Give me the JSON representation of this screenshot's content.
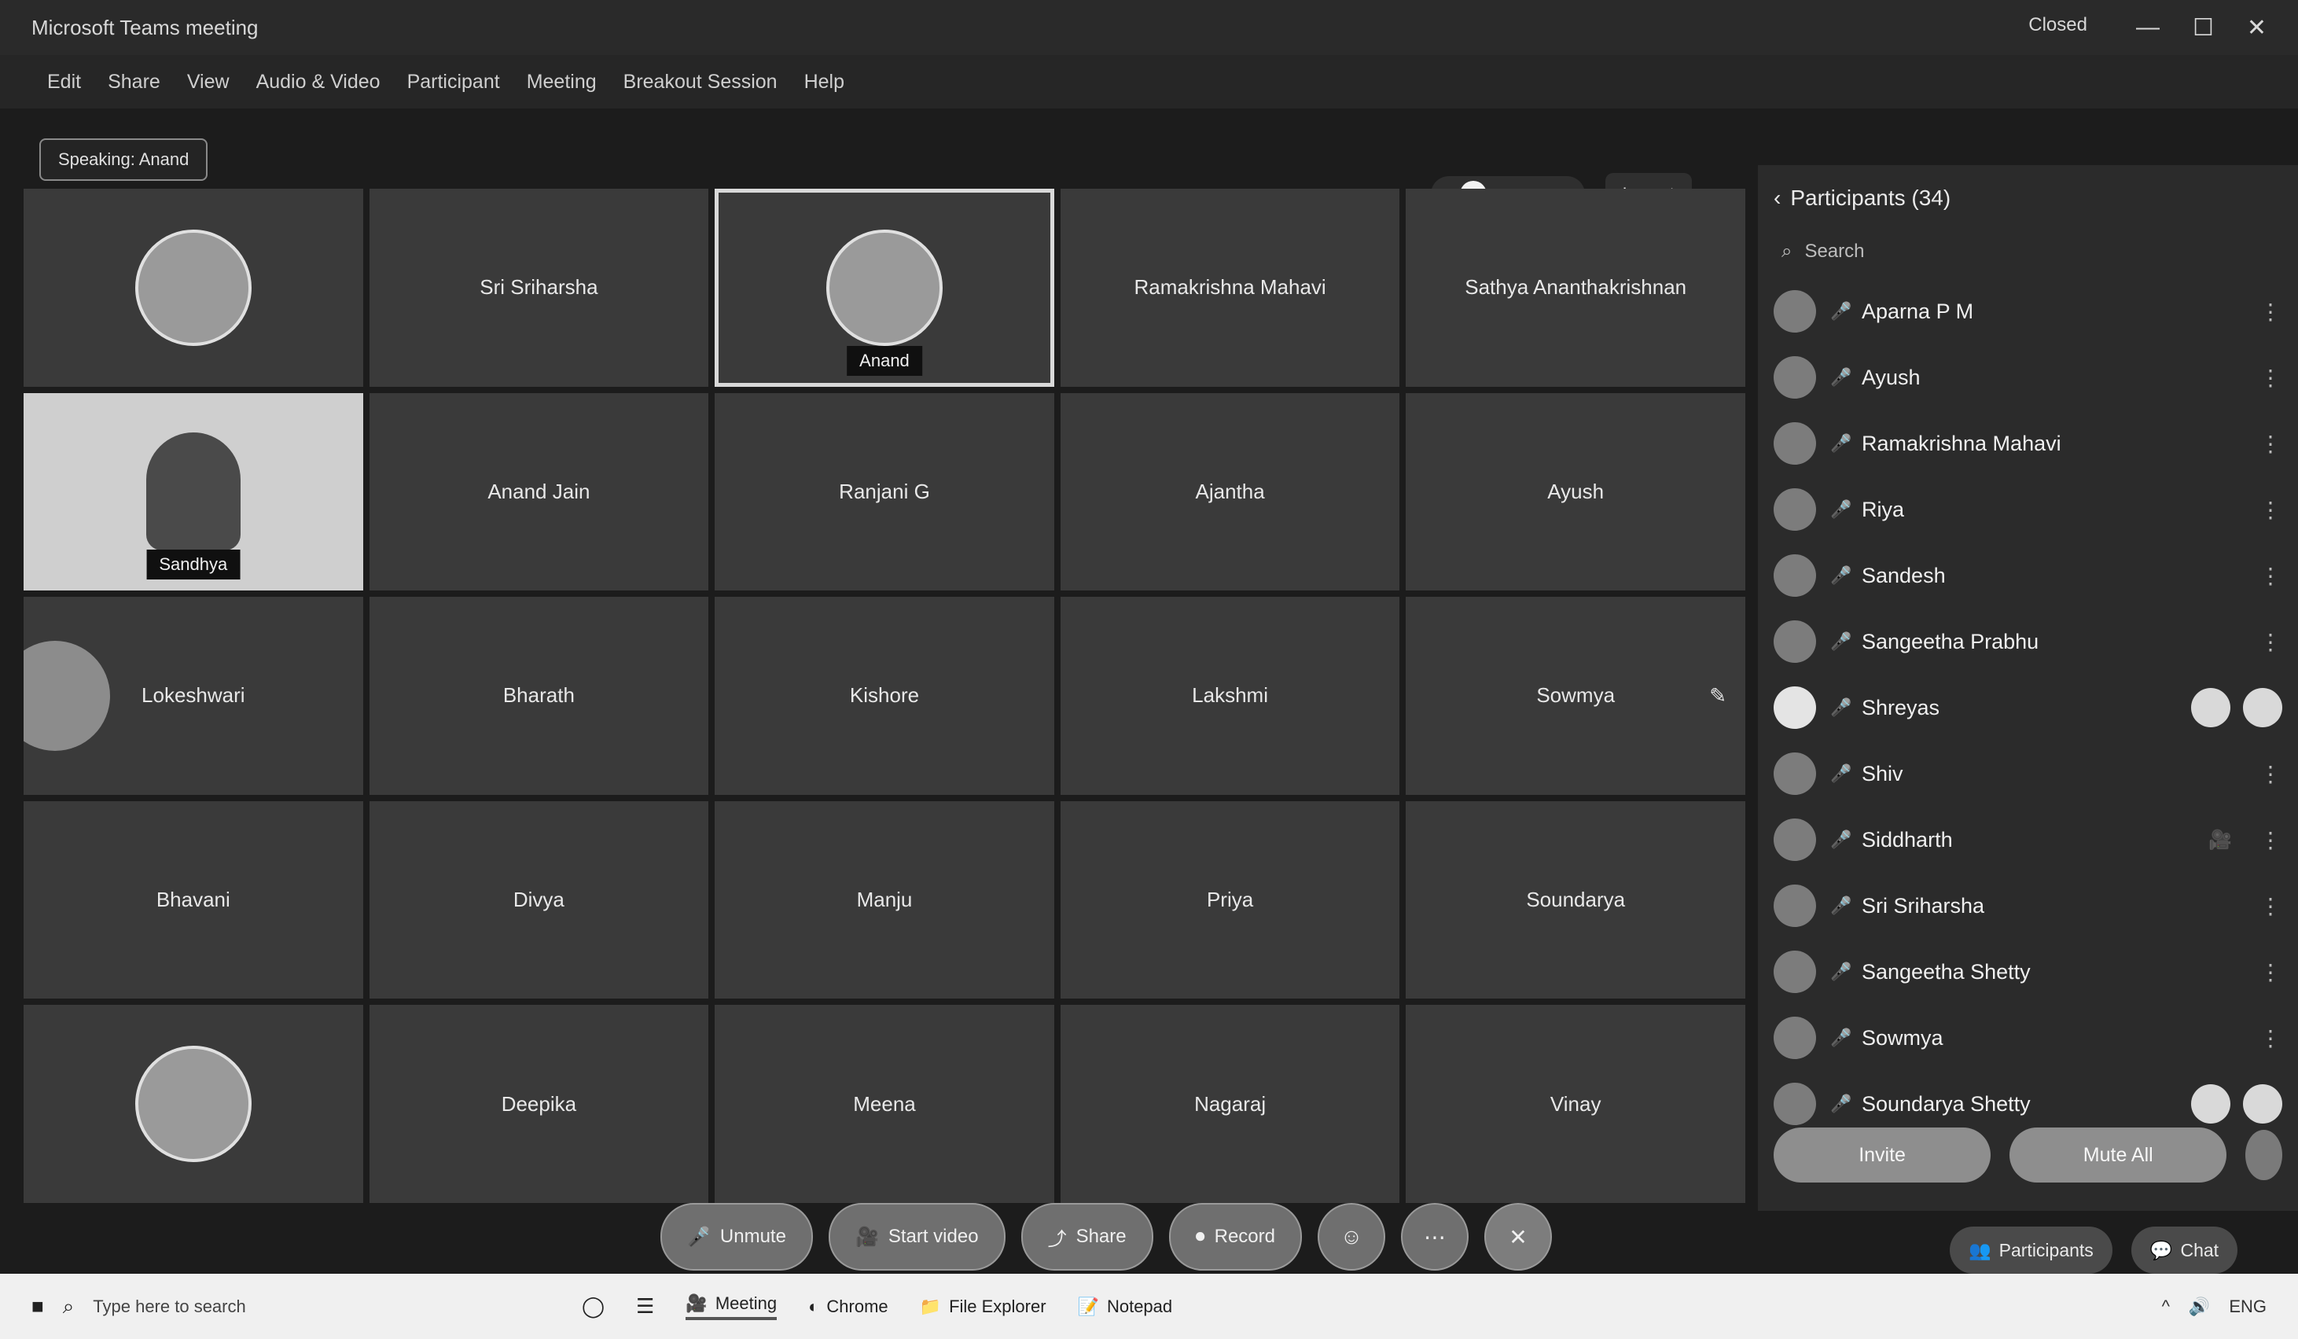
{
  "window": {
    "title": "Microsoft Teams meeting",
    "caption": "Closed",
    "controls": [
      "—",
      "☐",
      "✕"
    ]
  },
  "menu": [
    "Edit",
    "Share",
    "View",
    "Audio & Video",
    "Participant",
    "Meeting",
    "Breakout Session",
    "Help"
  ],
  "speaker_chip": "Speaking: Anand",
  "view": {
    "zoom_label": "—",
    "layout_label": "Layout"
  },
  "grid": {
    "tiles": [
      {
        "kind": "avatar",
        "name": ""
      },
      {
        "kind": "text",
        "name": "Sri Sriharsha"
      },
      {
        "kind": "avatar_active",
        "name": "",
        "caption": "Anand"
      },
      {
        "kind": "text",
        "name": "Ramakrishna Mahavi"
      },
      {
        "kind": "text",
        "name": "Sathya Ananthakrishnan"
      },
      {
        "kind": "video",
        "name": "",
        "caption": "Sandhya"
      },
      {
        "kind": "text",
        "name": "Anand Jain"
      },
      {
        "kind": "text",
        "name": "Ranjani G"
      },
      {
        "kind": "text",
        "name": "Ajantha"
      },
      {
        "kind": "text",
        "name": "Ayush"
      },
      {
        "kind": "blob",
        "name": "Lokeshwari"
      },
      {
        "kind": "text",
        "name": "Bharath"
      },
      {
        "kind": "text",
        "name": "Kishore"
      },
      {
        "kind": "text",
        "name": "Lakshmi"
      },
      {
        "kind": "text_mark",
        "name": "Sowmya",
        "mark": "✎"
      },
      {
        "kind": "text",
        "name": "Bhavani"
      },
      {
        "kind": "text",
        "name": "Divya"
      },
      {
        "kind": "text",
        "name": "Manju"
      },
      {
        "kind": "text",
        "name": "Priya"
      },
      {
        "kind": "text",
        "name": "Soundarya"
      },
      {
        "kind": "avatar",
        "name": ""
      },
      {
        "kind": "text",
        "name": "Deepika"
      },
      {
        "kind": "text",
        "name": "Meena"
      },
      {
        "kind": "text",
        "name": "Nagaraj"
      },
      {
        "kind": "text",
        "name": "Vinay"
      }
    ]
  },
  "participants": {
    "header": "Participants (34)",
    "search_placeholder": "Search",
    "list": [
      {
        "name": "Aparna P M",
        "mic": "🎤"
      },
      {
        "name": "Ayush",
        "mic": "🎤"
      },
      {
        "name": "Ramakrishna Mahavi",
        "mic": "🎤"
      },
      {
        "name": "Riya",
        "mic": "🎤"
      },
      {
        "name": "Sandesh",
        "mic": "🎤"
      },
      {
        "name": "Sangeetha Prabhu",
        "mic": "🎤"
      },
      {
        "name": "Shreyas",
        "mic": "🎤",
        "active": true,
        "actions": true
      },
      {
        "name": "Shiv",
        "mic": "🎤"
      },
      {
        "name": "Siddharth",
        "mic": "🎤",
        "badge": "🎥"
      },
      {
        "name": "Sri Sriharsha",
        "mic": "🎤"
      },
      {
        "name": "Sangeetha Shetty",
        "mic": "🎤"
      },
      {
        "name": "Sowmya",
        "mic": "🎤"
      },
      {
        "name": "Soundarya Shetty",
        "mic": "🎤",
        "actions": true
      }
    ],
    "footer_buttons": [
      "Invite",
      "Mute All"
    ]
  },
  "controls": [
    {
      "label": "Unmute",
      "icon": "🎤"
    },
    {
      "label": "Start video",
      "icon": "🎥"
    },
    {
      "label": "Share",
      "icon": "⤴"
    },
    {
      "label": "Record",
      "icon": "⏺"
    }
  ],
  "round_controls": [
    "☺",
    "⋯",
    "✕"
  ],
  "right_bottom": [
    "Participants",
    "Chat"
  ],
  "taskbar": {
    "search": "Type here to search",
    "items": [
      "Meeting",
      "Chrome",
      "File Explorer",
      "Notepad"
    ],
    "tray": [
      "^",
      "🔊",
      "ENG"
    ]
  }
}
